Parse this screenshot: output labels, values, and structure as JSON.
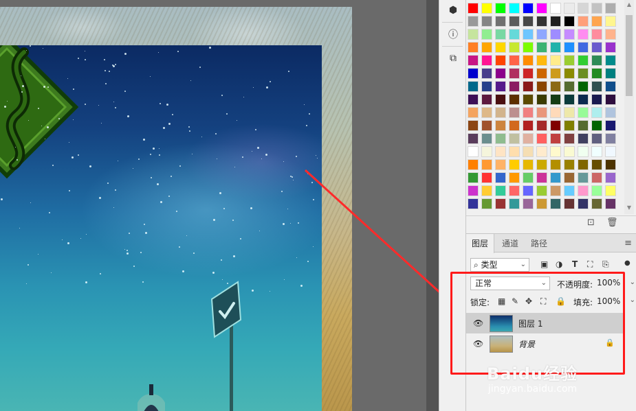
{
  "panels": {
    "tabs": [
      {
        "label": "图层",
        "active": true
      },
      {
        "label": "通道",
        "active": false
      },
      {
        "label": "路径",
        "active": false
      }
    ]
  },
  "filter": {
    "kind_label": "类型"
  },
  "blend": {
    "mode": "正常",
    "opacity_label": "不透明度:",
    "opacity_value": "100%",
    "lock_label": "锁定:",
    "fill_label": "填充:",
    "fill_value": "100%"
  },
  "layers": [
    {
      "name": "图层 1",
      "selected": true,
      "locked": false
    },
    {
      "name": "背景",
      "selected": false,
      "locked": true
    }
  ],
  "watermark": {
    "brand": "Baidu经验",
    "site": "jingyan.baidu.com"
  },
  "swatch_colors": [
    [
      "#ff0000",
      "#ffff00",
      "#00ff00",
      "#00ffff",
      "#0000ff",
      "#ff00ff",
      "#ffffff",
      "#ebebeb",
      "#d6d6d6",
      "#c2c2c2",
      "#adadad"
    ],
    [
      "#999999",
      "#858585",
      "#707070",
      "#5c5c5c",
      "#474747",
      "#333333",
      "#1f1f1f",
      "#000000",
      "#ffa07a",
      "#ffa54f",
      "#fff68f"
    ],
    [
      "#c6e59d",
      "#90ee90",
      "#78d8a3",
      "#66d9d9",
      "#6ec6ff",
      "#8ea7ff",
      "#9e8cff",
      "#c58cff",
      "#ff8cf0",
      "#ff8c9e",
      "#ffb38c"
    ],
    [
      "#ff7f24",
      "#ffa500",
      "#ffd700",
      "#c7e830",
      "#7cfc00",
      "#3cb371",
      "#20b2aa",
      "#1e90ff",
      "#4169e1",
      "#6a5acd",
      "#9932cc"
    ],
    [
      "#c71585",
      "#ff1493",
      "#ff4500",
      "#ff6347",
      "#ff8c00",
      "#ffb90f",
      "#ffec8b",
      "#9acd32",
      "#32cd32",
      "#2e8b57",
      "#008b8b"
    ],
    [
      "#0000cd",
      "#483d8b",
      "#8b008b",
      "#b03060",
      "#cd2626",
      "#cd6600",
      "#cd9b1d",
      "#8b8b00",
      "#6b8e23",
      "#228b22",
      "#008080"
    ],
    [
      "#00688b",
      "#27408b",
      "#551a8b",
      "#8b1c62",
      "#8b1a1a",
      "#8b4500",
      "#8b6914",
      "#556b2f",
      "#006400",
      "#2f4f4f",
      "#104e8b"
    ],
    [
      "#3d0f56",
      "#5d1a3f",
      "#4a1010",
      "#5c2e00",
      "#5c4a00",
      "#3b3b00",
      "#143d14",
      "#0b3b3b",
      "#0b2a4f",
      "#1a1a4f",
      "#2e0e3e"
    ],
    [
      "#f4a460",
      "#deb887",
      "#d2b48c",
      "#bc8f8f",
      "#f08080",
      "#e9967a",
      "#ffdab9",
      "#eee8aa",
      "#98fb98",
      "#afeeee",
      "#b0c4de"
    ],
    [
      "#8b4513",
      "#a0522d",
      "#cd853f",
      "#d2691e",
      "#b22222",
      "#a52a2a",
      "#800000",
      "#808000",
      "#556b2f",
      "#006400",
      "#191970"
    ],
    [
      "#5a3d5c",
      "#6b8e8e",
      "#8fbc8f",
      "#c0c0a0",
      "#e0b0a0",
      "#ff6060",
      "#c04040",
      "#804040",
      "#404060",
      "#606080",
      "#8080a0"
    ],
    [
      "#ffffff",
      "#f5f5dc",
      "#ffe4c4",
      "#ffdead",
      "#f5deb3",
      "#ffebcd",
      "#fffacd",
      "#fafad2",
      "#f0fff0",
      "#f0ffff",
      "#f0f8ff"
    ],
    [
      "#ff8000",
      "#ff9933",
      "#ffb366",
      "#ffcc00",
      "#e6b800",
      "#ccaa00",
      "#b38f00",
      "#998000",
      "#806600",
      "#664d00",
      "#4d3300"
    ],
    [
      "#339933",
      "#ff3333",
      "#3366cc",
      "#ff9900",
      "#66cc66",
      "#cc3399",
      "#3399cc",
      "#996633",
      "#669999",
      "#cc6666",
      "#9966cc"
    ],
    [
      "#cc33cc",
      "#ffcc33",
      "#33cc99",
      "#ff6666",
      "#6666ff",
      "#99cc33",
      "#cc9966",
      "#66ccff",
      "#ff99cc",
      "#99ff99",
      "#ffff66"
    ],
    [
      "#333399",
      "#669933",
      "#993333",
      "#339999",
      "#996699",
      "#cc9933",
      "#336666",
      "#663333",
      "#333366",
      "#666633",
      "#663366"
    ]
  ]
}
